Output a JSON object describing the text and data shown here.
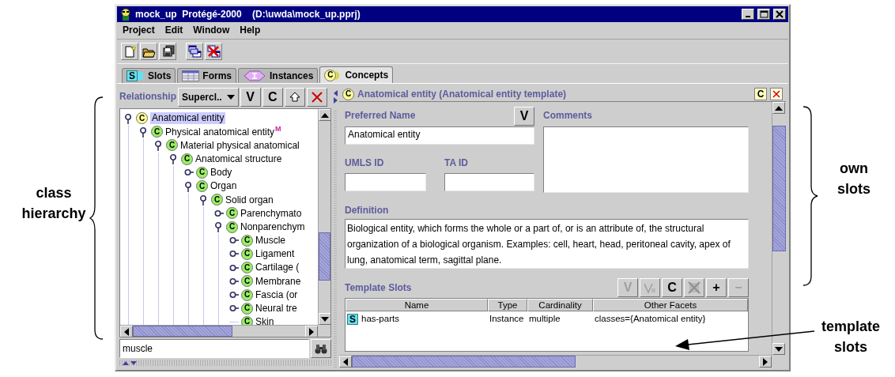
{
  "window": {
    "title": "mock_up  Protégé-2000    (D:\\uwda\\mock_up.pprj)"
  },
  "menu": [
    "Project",
    "Edit",
    "Window",
    "Help"
  ],
  "tabs": [
    {
      "label": "Slots",
      "kind": "slots",
      "badge": "S",
      "selected": false
    },
    {
      "label": "Forms",
      "kind": "forms",
      "selected": false
    },
    {
      "label": "Instances",
      "kind": "instances",
      "selected": false
    },
    {
      "label": "Concepts",
      "kind": "concepts",
      "badge": "C",
      "selected": true
    }
  ],
  "class_pane": {
    "relationship_label": "Relationship",
    "relationship_value": "Supercl..",
    "buttons": [
      "V",
      "C"
    ],
    "tree": [
      {
        "label": "Anatomical entity",
        "badge": "C",
        "color": "#ffff99",
        "expanded": true,
        "selected": true,
        "children": [
          {
            "label": "Physical anatomical entity",
            "badge": "C",
            "color": "#99ee66",
            "marker": "M",
            "expanded": true,
            "selected": false,
            "children": [
              {
                "label": "Material physical anatomical",
                "badge": "C",
                "color": "#99ee66",
                "expanded": true,
                "selected": false,
                "children": [
                  {
                    "label": "Anatomical structure",
                    "badge": "C",
                    "color": "#99ee66",
                    "expanded": true,
                    "selected": false,
                    "children": [
                      {
                        "label": "Body",
                        "badge": "C",
                        "color": "#99ee66",
                        "expanded": false,
                        "selected": false
                      },
                      {
                        "label": "Organ",
                        "badge": "C",
                        "color": "#99ee66",
                        "expanded": true,
                        "selected": false,
                        "children": [
                          {
                            "label": "Solid organ",
                            "badge": "C",
                            "color": "#99ee66",
                            "expanded": true,
                            "selected": false,
                            "children": [
                              {
                                "label": "Parenchymato",
                                "badge": "C",
                                "color": "#99ee66",
                                "expanded": false,
                                "selected": false
                              },
                              {
                                "label": "Nonparenchym",
                                "badge": "C",
                                "color": "#99ee66",
                                "expanded": true,
                                "selected": false,
                                "children": [
                                  {
                                    "label": "Muscle",
                                    "badge": "C",
                                    "color": "#99ee66",
                                    "expanded": false,
                                    "selected": false
                                  },
                                  {
                                    "label": "Ligament",
                                    "badge": "C",
                                    "color": "#99ee66",
                                    "expanded": false,
                                    "selected": false
                                  },
                                  {
                                    "label": "Cartilage (",
                                    "badge": "C",
                                    "color": "#99ee66",
                                    "expanded": false,
                                    "selected": false
                                  },
                                  {
                                    "label": "Membrane",
                                    "badge": "C",
                                    "color": "#99ee66",
                                    "expanded": false,
                                    "selected": false
                                  },
                                  {
                                    "label": "Fascia (or",
                                    "badge": "C",
                                    "color": "#99ee66",
                                    "expanded": false,
                                    "selected": false
                                  },
                                  {
                                    "label": "Neural tre",
                                    "badge": "C",
                                    "color": "#99ee66",
                                    "expanded": false,
                                    "selected": false
                                  },
                                  {
                                    "label": "Skin",
                                    "badge": "C",
                                    "color": "#99ee66",
                                    "selected": false
                                  }
                                ]
                              }
                            ]
                          }
                        ]
                      }
                    ]
                  }
                ]
              }
            ]
          }
        ]
      }
    ],
    "search": {
      "value": "muscle"
    }
  },
  "form": {
    "header": {
      "badge": "C",
      "title": "Anatomical entity (Anatomical entity template)",
      "button": "C"
    },
    "preferred_name": {
      "label": "Preferred Name",
      "value": "Anatomical entity",
      "button": "V"
    },
    "comments": {
      "label": "Comments"
    },
    "umls_id": {
      "label": "UMLS ID"
    },
    "ta_id": {
      "label": "TA ID"
    },
    "definition": {
      "label": "Definition",
      "value": "Biological entity, which forms the whole or a part of, or is an attribute of, the structural organization of a biological organism. Examples: cell, heart, head, peritoneal cavity, apex of lung, anatomical term, sagittal plane."
    },
    "template_slots": {
      "label": "Template Slots",
      "buttons": [
        {
          "kind": "text",
          "label": "V",
          "disabled": true
        },
        {
          "kind": "edit-icon",
          "disabled": true
        },
        {
          "kind": "text",
          "label": "C",
          "disabled": false
        },
        {
          "kind": "delete-icon",
          "disabled": true
        },
        {
          "kind": "text",
          "label": "+",
          "disabled": false
        },
        {
          "kind": "text",
          "label": "−",
          "disabled": true
        }
      ],
      "columns": [
        "Name",
        "Type",
        "Cardinality",
        "Other Facets"
      ],
      "rows": [
        {
          "badge": "S",
          "name": "has-parts",
          "type": "Instance",
          "cardinality": "multiple",
          "other_facets": "classes={Anatomical entity}"
        }
      ]
    }
  },
  "annotations": [
    {
      "kind": "left-brace",
      "text": "class hierarchy"
    },
    {
      "kind": "right-brace",
      "text": "own slots"
    },
    {
      "kind": "arrow",
      "text": "template slots"
    }
  ]
}
